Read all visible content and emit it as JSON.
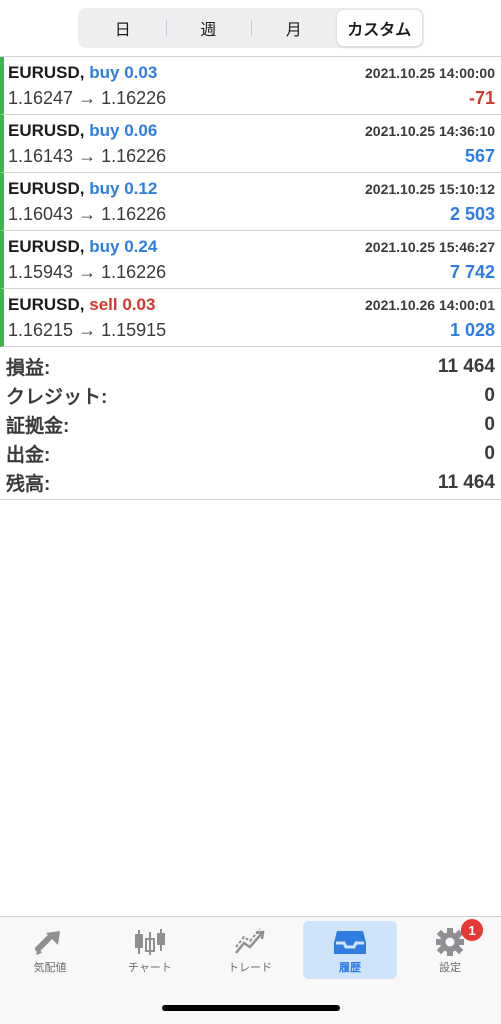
{
  "period_tabs": [
    {
      "label": "日"
    },
    {
      "label": "週"
    },
    {
      "label": "月"
    },
    {
      "label": "カスタム"
    }
  ],
  "trades": [
    {
      "symbol": "EURUSD,",
      "side": "buy",
      "side_label": "buy 0.03",
      "time": "2021.10.25 14:00:00",
      "prices": "1.16247 → 1.16226",
      "profit": "-71"
    },
    {
      "symbol": "EURUSD,",
      "side": "buy",
      "side_label": "buy 0.06",
      "time": "2021.10.25 14:36:10",
      "prices": "1.16143 → 1.16226",
      "profit": "567"
    },
    {
      "symbol": "EURUSD,",
      "side": "buy",
      "side_label": "buy 0.12",
      "time": "2021.10.25 15:10:12",
      "prices": "1.16043 → 1.16226",
      "profit": "2 503"
    },
    {
      "symbol": "EURUSD,",
      "side": "buy",
      "side_label": "buy 0.24",
      "time": "2021.10.25 15:46:27",
      "prices": "1.15943 → 1.16226",
      "profit": "7 742"
    },
    {
      "symbol": "EURUSD,",
      "side": "sell",
      "side_label": "sell 0.03",
      "time": "2021.10.26 14:00:01",
      "prices": "1.16215 → 1.15915",
      "profit": "1 028"
    }
  ],
  "summary": [
    {
      "label": "損益:",
      "value": "11 464"
    },
    {
      "label": "クレジット:",
      "value": "0"
    },
    {
      "label": "証拠金:",
      "value": "0"
    },
    {
      "label": "出金:",
      "value": "0"
    },
    {
      "label": "残高:",
      "value": "11 464"
    }
  ],
  "tabbar": [
    {
      "label": "気配値",
      "icon": "quotes-icon"
    },
    {
      "label": "チャート",
      "icon": "candlestick-chart-icon"
    },
    {
      "label": "トレード",
      "icon": "trade-trend-icon"
    },
    {
      "label": "履歴",
      "icon": "history-tray-icon"
    },
    {
      "label": "設定",
      "icon": "gear-icon",
      "badge": "1"
    }
  ],
  "colors": {
    "buy": "#2f7de1",
    "sell": "#d0392b",
    "profit_positive": "#2f7de1",
    "profit_negative": "#d0392b",
    "trade_marker": "#39b54a",
    "active_tab_bg": "#cfe3fa",
    "badge": "#e53935"
  }
}
